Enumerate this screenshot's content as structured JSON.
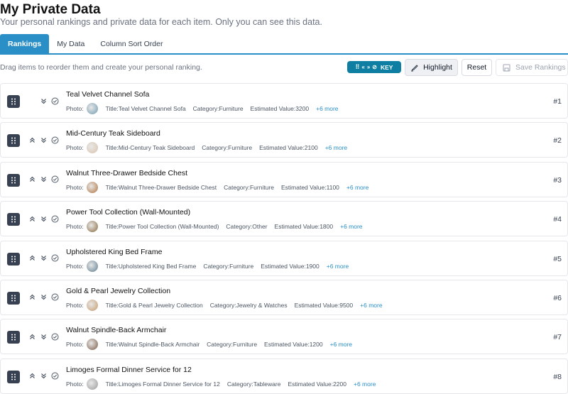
{
  "page": {
    "title": "My Private Data",
    "subtitle": "Your personal rankings and private data for each item. Only you can see this data."
  },
  "tabs": [
    {
      "label": "Rankings",
      "active": true
    },
    {
      "label": "My Data",
      "active": false
    },
    {
      "label": "Column Sort Order",
      "active": false
    }
  ],
  "toolbar": {
    "hint": "Drag items to reorder them and create your personal ranking.",
    "key_label": "KEY",
    "highlight_label": "Highlight",
    "reset_label": "Reset",
    "save_label": "Save Rankings"
  },
  "labels": {
    "photo": "Photo:",
    "title": "Title:",
    "category": "Category:",
    "value": "Estimated Value:"
  },
  "colors": {
    "accent": "#2a8fc7",
    "key_badge": "#0e7fa3",
    "handle": "#374151"
  },
  "items": [
    {
      "title": "Teal Velvet Channel Sofa",
      "category": "Furniture",
      "value": "3200",
      "more": "+6 more",
      "rank": "#1",
      "show_up": false,
      "thumb": "#6f9bb0"
    },
    {
      "title": "Mid-Century Teak Sideboard",
      "category": "Furniture",
      "value": "2100",
      "more": "+6 more",
      "rank": "#2",
      "show_up": true,
      "thumb": "#d9c4ad"
    },
    {
      "title": "Walnut Three-Drawer Bedside Chest",
      "category": "Furniture",
      "value": "1100",
      "more": "+6 more",
      "rank": "#3",
      "show_up": true,
      "thumb": "#b0743f"
    },
    {
      "title": "Power Tool Collection (Wall-Mounted)",
      "category": "Other",
      "value": "1800",
      "more": "+6 more",
      "rank": "#4",
      "show_up": true,
      "thumb": "#8a6a3e"
    },
    {
      "title": "Upholstered King Bed Frame",
      "category": "Furniture",
      "value": "1900",
      "more": "+6 more",
      "rank": "#5",
      "show_up": true,
      "thumb": "#5f7c8f"
    },
    {
      "title": "Gold & Pearl Jewelry Collection",
      "category": "Jewelry & Watches",
      "value": "9500",
      "more": "+6 more",
      "rank": "#6",
      "show_up": true,
      "thumb": "#c59a6b"
    },
    {
      "title": "Walnut Spindle-Back Armchair",
      "category": "Furniture",
      "value": "1200",
      "more": "+6 more",
      "rank": "#7",
      "show_up": true,
      "thumb": "#7a5a44"
    },
    {
      "title": "Limoges Formal Dinner Service for 12",
      "category": "Tableware",
      "value": "2200",
      "more": "+6 more",
      "rank": "#8",
      "show_up": true,
      "thumb": "#9a9a9a"
    }
  ]
}
